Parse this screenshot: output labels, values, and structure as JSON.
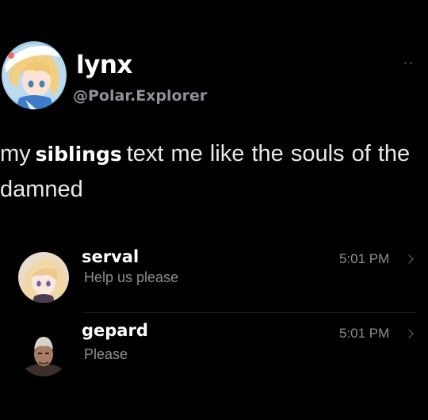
{
  "post": {
    "author_name": "lynx",
    "author_handle": "@Polar.Explorer",
    "avatar_icon": "lynx-avatar-icon",
    "text_before": "my",
    "text_emphasis": "siblings",
    "text_after": "text me like the souls of the damned"
  },
  "messages": [
    {
      "sender": "serval",
      "preview": "Help us please",
      "time": "5:01 PM",
      "avatar_icon": "serval-avatar-icon"
    },
    {
      "sender": "gepard",
      "preview": "Please",
      "time": "5:01 PM",
      "avatar_icon": "gepard-avatar-icon"
    }
  ],
  "colors": {
    "background": "#000000",
    "primary_text": "#e7e9ea",
    "secondary_text": "#8b8f93"
  }
}
